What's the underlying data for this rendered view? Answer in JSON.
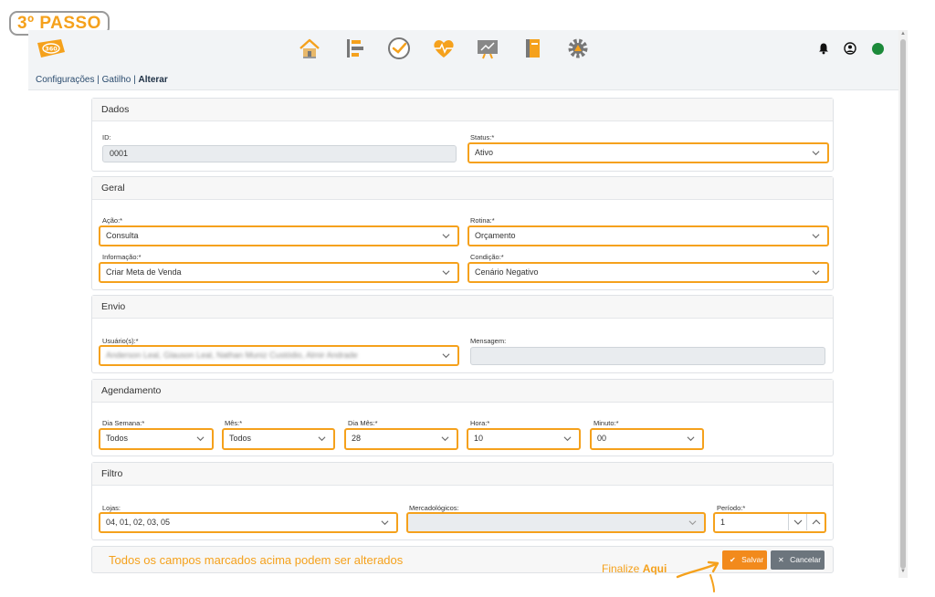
{
  "step_badge": "3º PASSO",
  "app": {
    "logo_text": "360",
    "nav_icons": [
      "home-icon",
      "list-flow-icon",
      "check-circle-icon",
      "heart-pulse-icon",
      "chart-board-icon",
      "notebook-icon",
      "gear-icon"
    ],
    "right_icons": [
      "bell-icon",
      "user-circle-icon"
    ],
    "status_color": "#1c8a3a",
    "accent_color": "#f5a11c"
  },
  "breadcrumb": {
    "part1": "Configurações",
    "sep1": " | ",
    "part2": "Gatilho",
    "sep2": " | ",
    "current": "Alterar"
  },
  "sections": {
    "dados": {
      "title": "Dados",
      "id_label": "ID:",
      "id_value": "0001",
      "status_label": "Status:*",
      "status_value": "Ativo"
    },
    "geral": {
      "title": "Geral",
      "acao_label": "Ação:*",
      "acao_value": "Consulta",
      "rotina_label": "Rotina:*",
      "rotina_value": "Orçamento",
      "informacao_label": "Informação:*",
      "informacao_value": "Criar Meta de Venda",
      "condicao_label": "Condição:*",
      "condicao_value": "Cenário Negativo"
    },
    "envio": {
      "title": "Envio",
      "usuarios_label": "Usuário(s):*",
      "usuarios_value": "Anderson Leal, Glauson Leal, Nathan Muniz Custódio, Almir Andrade",
      "mensagem_label": "Mensagem:",
      "mensagem_value": ""
    },
    "agendamento": {
      "title": "Agendamento",
      "dia_semana_label": "Dia Semana:*",
      "dia_semana_value": "Todos",
      "mes_label": "Mês:*",
      "mes_value": "Todos",
      "dia_mes_label": "Dia Mês:*",
      "dia_mes_value": "28",
      "hora_label": "Hora:*",
      "hora_value": "10",
      "minuto_label": "Minuto:*",
      "minuto_value": "00"
    },
    "filtro": {
      "title": "Filtro",
      "lojas_label": "Lojas:",
      "lojas_value": "04, 01, 02, 03, 05",
      "mercadologicos_label": "Mercadológicos:",
      "mercadologicos_value": "",
      "periodo_label": "Período:*",
      "periodo_value": "1"
    }
  },
  "footer": {
    "note": "Todos os campos marcados acima podem ser alterados",
    "save_label": "Salvar",
    "cancel_label": "Cancelar"
  },
  "callout": {
    "prefix": "Finalize ",
    "bold": "Aqui"
  }
}
